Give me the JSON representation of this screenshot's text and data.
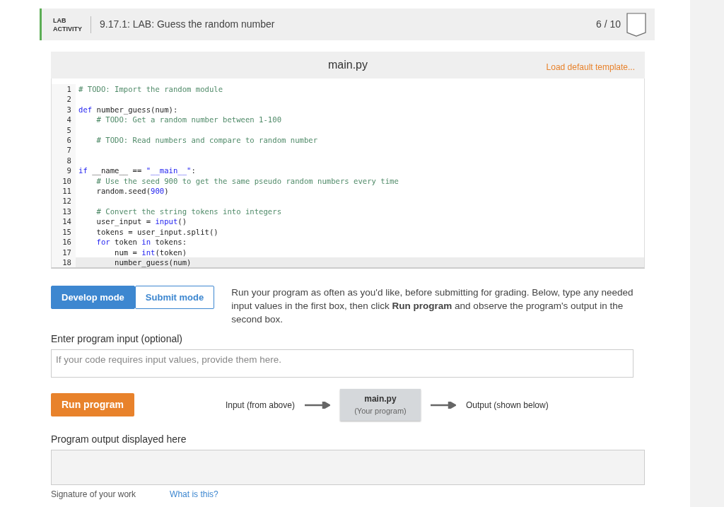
{
  "header": {
    "label_line1": "LAB",
    "label_line2": "ACTIVITY",
    "title": "9.17.1: LAB: Guess the random number",
    "score": "6 / 10",
    "completed": false
  },
  "editor": {
    "filename": "main.py",
    "template_link": "Load default template...",
    "lines": [
      {
        "number": "1",
        "current": false,
        "tokens": [
          {
            "kind": "comment",
            "text": "# TODO: Import the random module"
          }
        ]
      },
      {
        "number": "2",
        "current": false
      },
      {
        "number": "3",
        "current": false,
        "tokens": [
          {
            "kind": "keyword",
            "text": "def"
          },
          {
            "kind": "plain",
            "text": " number_guess(num):"
          }
        ]
      },
      {
        "number": "4",
        "current": false,
        "tokens": [
          {
            "kind": "comment",
            "text": "    # TODO: Get a random number between 1-100"
          }
        ]
      },
      {
        "number": "5",
        "current": false
      },
      {
        "number": "6",
        "current": false,
        "tokens": [
          {
            "kind": "comment",
            "text": "    # TODO: Read numbers and compare to random number"
          }
        ]
      },
      {
        "number": "7",
        "current": false
      },
      {
        "number": "8",
        "current": false
      },
      {
        "number": "9",
        "current": false,
        "tokens": [
          {
            "kind": "keyword",
            "text": "if"
          },
          {
            "kind": "plain",
            "text": " __name__ == "
          },
          {
            "kind": "string",
            "text": "\"__main__\""
          },
          {
            "kind": "plain",
            "text": ":"
          }
        ]
      },
      {
        "number": "10",
        "current": false,
        "tokens": [
          {
            "kind": "comment",
            "text": "    # Use the seed 900 to get the same pseudo random numbers every time"
          }
        ]
      },
      {
        "number": "11",
        "current": false,
        "tokens": [
          {
            "kind": "plain",
            "text": "    random.seed("
          },
          {
            "kind": "number",
            "text": "900"
          },
          {
            "kind": "plain",
            "text": ")"
          }
        ]
      },
      {
        "number": "12",
        "current": false
      },
      {
        "number": "13",
        "current": false,
        "tokens": [
          {
            "kind": "comment",
            "text": "    # Convert the string tokens into integers"
          }
        ]
      },
      {
        "number": "14",
        "current": false,
        "tokens": [
          {
            "kind": "plain",
            "text": "    user_input = "
          },
          {
            "kind": "builtin",
            "text": "input"
          },
          {
            "kind": "plain",
            "text": "()"
          }
        ]
      },
      {
        "number": "15",
        "current": false,
        "tokens": [
          {
            "kind": "plain",
            "text": "    tokens = user_input.split()"
          }
        ]
      },
      {
        "number": "16",
        "current": false,
        "tokens": [
          {
            "kind": "keyword",
            "text": "    for"
          },
          {
            "kind": "plain",
            "text": " token "
          },
          {
            "kind": "keyword",
            "text": "in"
          },
          {
            "kind": "plain",
            "text": " tokens:"
          }
        ]
      },
      {
        "number": "17",
        "current": false,
        "tokens": [
          {
            "kind": "plain",
            "text": "        num = "
          },
          {
            "kind": "builtin",
            "text": "int"
          },
          {
            "kind": "plain",
            "text": "(token)"
          }
        ]
      },
      {
        "number": "18",
        "current": true,
        "tokens": [
          {
            "kind": "plain",
            "text": "        number_guess(num)"
          }
        ]
      }
    ]
  },
  "modes": [
    {
      "label": "Develop mode",
      "selected": true
    },
    {
      "label": "Submit mode",
      "selected": false
    }
  ],
  "instructions": "Run your program as often as you'd like, before submitting for grading. Below, type any needed input values in the first box, then click **Run program** and observe the program's output in the second box.",
  "input": {
    "label": "Enter program input (optional)",
    "placeholder": "If your code requires input values, provide them here."
  },
  "run_button": "Run program",
  "flow": {
    "input_label": "Input (from above)",
    "program_name": "main.py",
    "program_caption": "(Your program)",
    "output_label": "Output (shown below)"
  },
  "output": {
    "label": "Program output displayed here"
  },
  "footer": {
    "signature_label": "Signature of your work",
    "help_link": "What is this?"
  }
}
